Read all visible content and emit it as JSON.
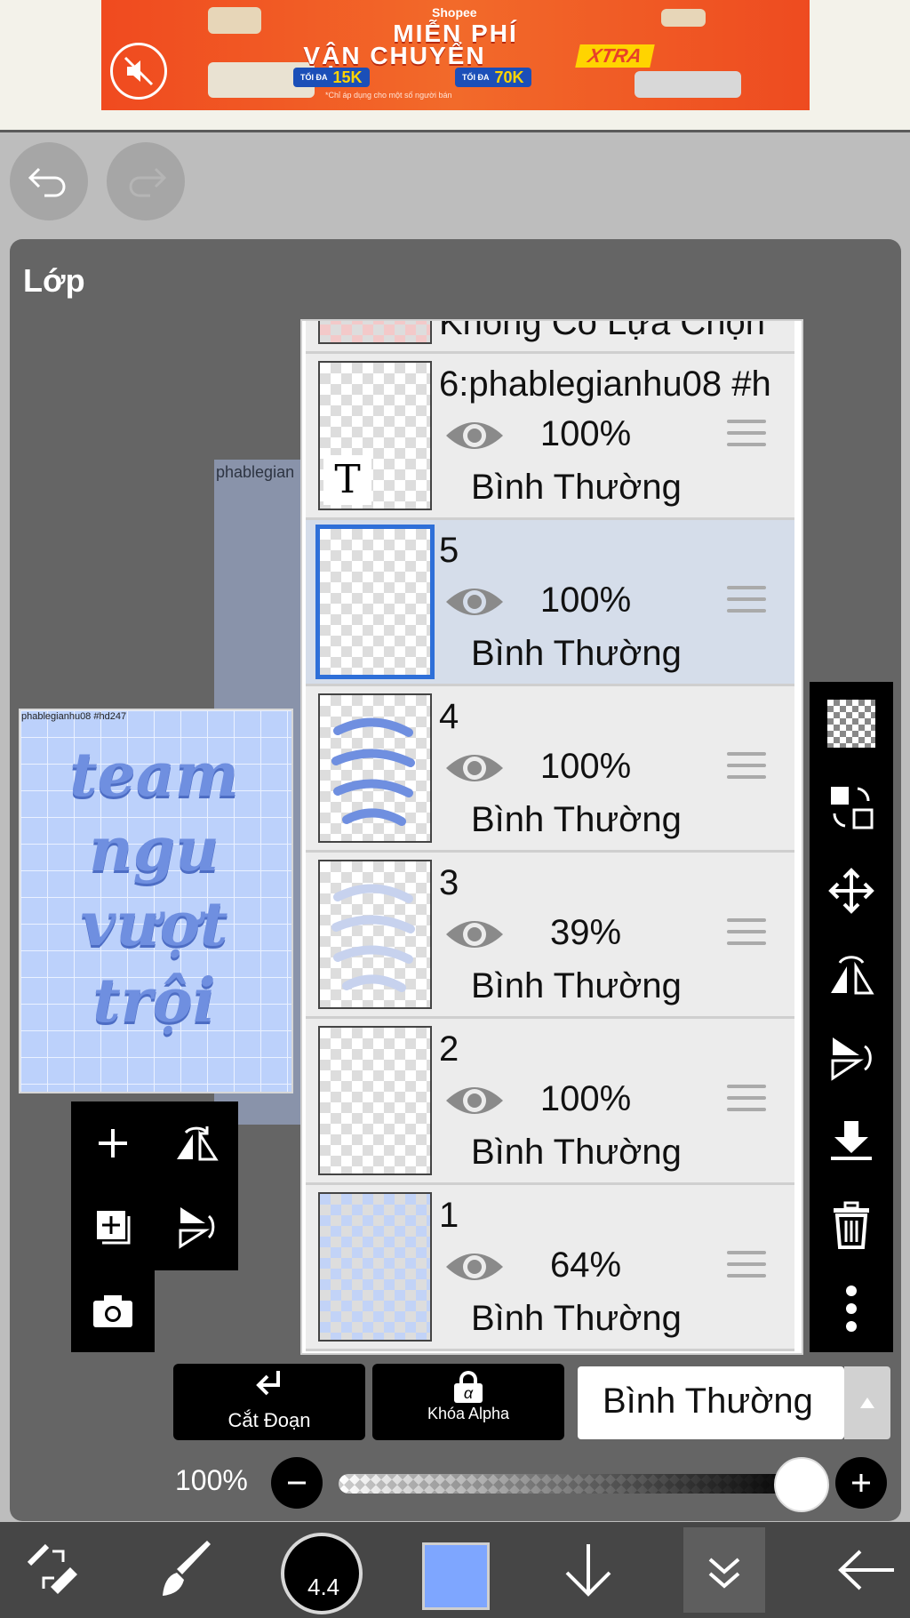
{
  "ad": {
    "brand": "Shopee",
    "title_line1": "MIỄN PHÍ",
    "title_line2": "VẬN CHUYỂN",
    "badge": "XTRA",
    "offer1_prefix": "TỐI ĐA",
    "offer1_value": "15K",
    "offer2_prefix": "TỐI ĐA",
    "offer2_value": "70K",
    "note": "*Chỉ áp dụng cho một số người bán"
  },
  "panel": {
    "title": "Lớp"
  },
  "canvas": {
    "caption": "phablegianhu08 #hd247",
    "ghost_label": "phablegian",
    "art_words": [
      "team",
      "ngu",
      "vượt",
      "trội"
    ]
  },
  "layers": [
    {
      "name": "Không Có Lựa Chọn",
      "partial": true
    },
    {
      "name": "6:phablegianhu08 #h",
      "opacity": "100%",
      "blend": "Bình Thường",
      "text_layer": true,
      "thumb_text": "T"
    },
    {
      "name": "5",
      "opacity": "100%",
      "blend": "Bình Thường",
      "selected": true
    },
    {
      "name": "4",
      "opacity": "100%",
      "blend": "Bình Thường"
    },
    {
      "name": "3",
      "opacity": "39%",
      "blend": "Bình Thường"
    },
    {
      "name": "2",
      "opacity": "100%",
      "blend": "Bình Thường"
    },
    {
      "name": "1",
      "opacity": "64%",
      "blend": "Bình Thường"
    }
  ],
  "controls": {
    "clip_label": "Cắt Đoạn",
    "alpha_lock_label": "Khóa Alpha",
    "alpha_symbol": "α",
    "blend_mode": "Bình Thường",
    "opacity_label": "100%",
    "opacity_value": 1.0
  },
  "bottom": {
    "brush_size": "4.4",
    "color": "#7ea6ff"
  },
  "colors": {
    "panel": "#656565",
    "selection_accent": "#2e6fd8",
    "selected_row": "#d5ddea"
  }
}
